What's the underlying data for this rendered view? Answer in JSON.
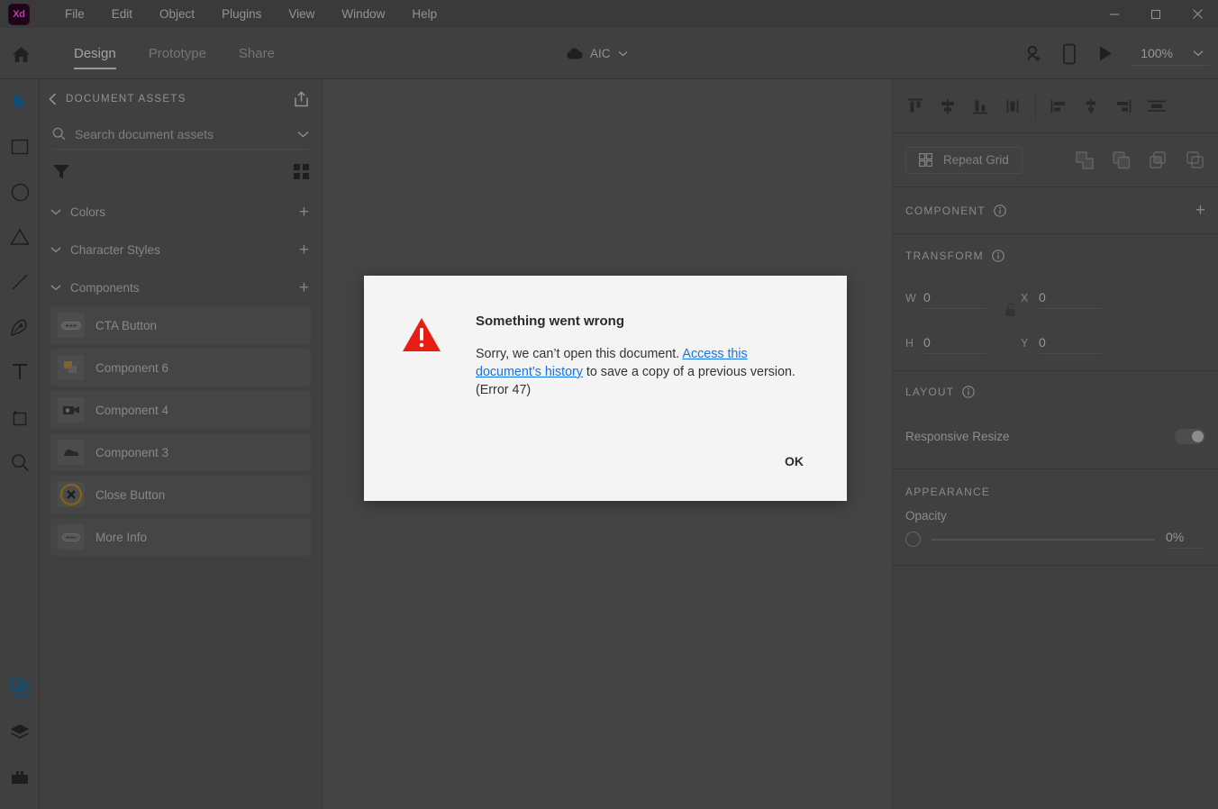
{
  "app": {
    "logo_text": "Xd",
    "accent_purple": "#2b0a23",
    "accent_pink": "#ff61f6"
  },
  "menubar": {
    "items": [
      "File",
      "Edit",
      "Object",
      "Plugins",
      "View",
      "Window",
      "Help"
    ]
  },
  "window_controls": {
    "minimize": "minimize",
    "maximize": "maximize",
    "close": "close"
  },
  "toolbar": {
    "home": "home",
    "tabs": [
      {
        "label": "Design",
        "active": true
      },
      {
        "label": "Prototype",
        "active": false
      },
      {
        "label": "Share",
        "active": false
      }
    ],
    "document_name": "AIC",
    "zoom_level": "100%",
    "icons": [
      "cloud-icon",
      "chevron-down-icon",
      "add-collaborator-icon",
      "device-preview-icon",
      "play-icon"
    ]
  },
  "tool_rail": {
    "tools": [
      {
        "name": "select-tool",
        "active": true
      },
      {
        "name": "rectangle-tool",
        "active": false
      },
      {
        "name": "ellipse-tool",
        "active": false
      },
      {
        "name": "polygon-tool",
        "active": false
      },
      {
        "name": "line-tool",
        "active": false
      },
      {
        "name": "pen-tool",
        "active": false
      },
      {
        "name": "text-tool",
        "active": false
      },
      {
        "name": "artboard-tool",
        "active": false
      },
      {
        "name": "zoom-tool",
        "active": false
      }
    ],
    "bottom": [
      {
        "name": "document-assets-panel",
        "active": true
      },
      {
        "name": "layers-panel",
        "active": false
      },
      {
        "name": "plugins-panel",
        "active": false
      }
    ]
  },
  "assets_panel": {
    "title": "DOCUMENT ASSETS",
    "share_icon": "share-icon",
    "back_icon": "chevron-left-icon",
    "search": {
      "placeholder": "Search document assets",
      "value": ""
    },
    "filter_icon": "filter-icon",
    "grid_view_icon": "grid-view-icon",
    "sections": [
      {
        "label": "Colors",
        "expanded": true
      },
      {
        "label": "Character Styles",
        "expanded": true
      },
      {
        "label": "Components",
        "expanded": true
      }
    ],
    "components": [
      {
        "label": "CTA Button",
        "thumb": "pill-button-thumb"
      },
      {
        "label": "Component 6",
        "thumb": "shapes-thumb"
      },
      {
        "label": "Component 4",
        "thumb": "camera-thumb"
      },
      {
        "label": "Component 3",
        "thumb": "object-thumb"
      },
      {
        "label": "Close Button",
        "thumb": "close-circle-thumb"
      },
      {
        "label": "More Info",
        "thumb": "pill-button-thumb"
      }
    ]
  },
  "properties_panel": {
    "align_icons": [
      "align-top-icon",
      "align-vertical-center-icon",
      "align-bottom-icon",
      "align-horizontal-center-icon",
      "distribute-left-icon",
      "distribute-vertical-icon",
      "distribute-right-icon",
      "distribute-horizontal-icon"
    ],
    "repeat_grid_label": "Repeat Grid",
    "repeat_grid_icon": "repeat-grid-icon",
    "boolean_icons": [
      "boolean-add-icon",
      "boolean-subtract-icon",
      "boolean-intersect-icon",
      "boolean-exclude-icon"
    ],
    "component": {
      "title": "COMPONENT",
      "info_icon": "info-icon",
      "add_label": "+"
    },
    "transform": {
      "title": "TRANSFORM",
      "info_icon": "info-icon",
      "w_label": "W",
      "w_value": "0",
      "h_label": "H",
      "h_value": "0",
      "x_label": "X",
      "x_value": "0",
      "y_label": "Y",
      "y_value": "0",
      "lock_icon": "unlocked-icon"
    },
    "layout": {
      "title": "LAYOUT",
      "info_icon": "info-icon",
      "responsive_resize_label": "Responsive Resize",
      "responsive_resize_on": true
    },
    "appearance": {
      "title": "APPEARANCE",
      "opacity_label": "Opacity",
      "opacity_value": "0%"
    }
  },
  "dialog": {
    "icon": "error-warning-icon",
    "title": "Something went wrong",
    "body_before": "Sorry, we can’t open this document. ",
    "link": "Access this document’s history",
    "body_after": " to save a copy of a previous version. (Error 47)",
    "ok_label": "OK",
    "link_color": "#1473e6"
  }
}
